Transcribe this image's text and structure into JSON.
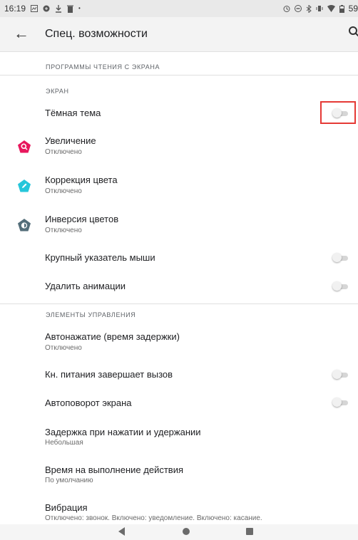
{
  "status_bar": {
    "time": "16:19",
    "battery": "59"
  },
  "header": {
    "title": "Спец. возможности"
  },
  "sections": {
    "screen_readers": "ПРОГРАММЫ ЧТЕНИЯ С ЭКРАНА",
    "screen": "ЭКРАН",
    "controls": "ЭЛЕМЕНТЫ УПРАВЛЕНИЯ"
  },
  "items": {
    "dark_theme": {
      "title": "Тёмная тема",
      "on": false
    },
    "magnification": {
      "title": "Увеличение",
      "subtitle": "Отключено",
      "icon": "magnify-icon",
      "color": "#e8175d"
    },
    "color_correction": {
      "title": "Коррекция цвета",
      "subtitle": "Отключено",
      "icon": "pencil-icon",
      "color": "#26c6da"
    },
    "color_inversion": {
      "title": "Инверсия цветов",
      "subtitle": "Отключено",
      "icon": "contrast-icon",
      "color": "#546e7a"
    },
    "large_pointer": {
      "title": "Крупный указатель мыши",
      "on": false
    },
    "remove_animations": {
      "title": "Удалить анимации",
      "on": false
    },
    "autoclick": {
      "title": "Автонажатие (время задержки)",
      "subtitle": "Отключено"
    },
    "power_ends_call": {
      "title": "Кн. питания завершает вызов",
      "on": false
    },
    "auto_rotate": {
      "title": "Автоповорот экрана",
      "on": false
    },
    "touch_hold_delay": {
      "title": "Задержка при нажатии и удержании",
      "subtitle": "Небольшая"
    },
    "time_to_act": {
      "title": "Время на выполнение действия",
      "subtitle": "По умолчанию"
    },
    "vibration": {
      "title": "Вибрация",
      "subtitle": "Отключено: звонок. Включено: уведомление. Включено: касание."
    }
  },
  "colors": {
    "highlight": "#e53935",
    "toggle_track": "#d6d6d6"
  }
}
